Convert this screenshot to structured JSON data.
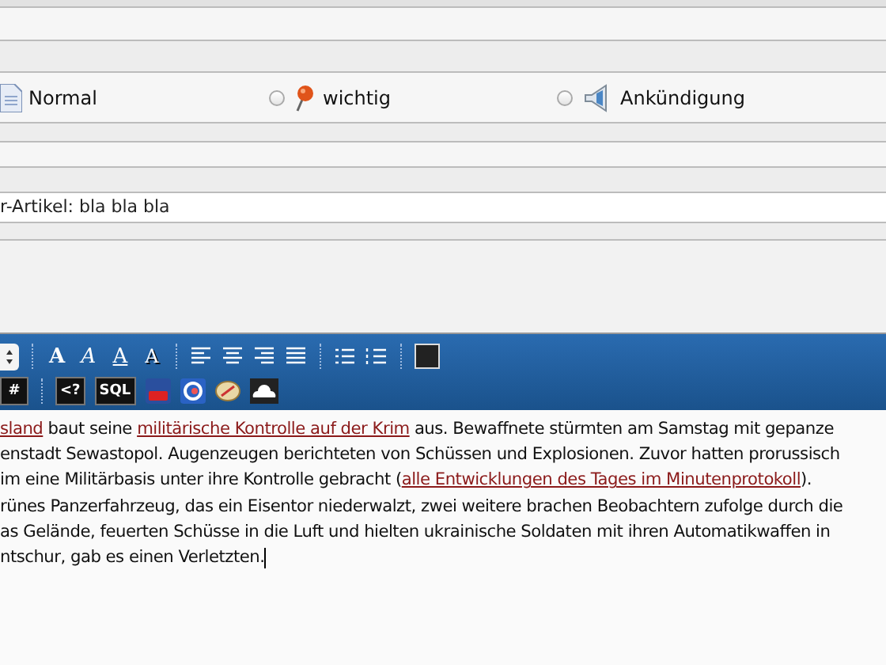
{
  "post_type": {
    "options": [
      {
        "label": "Normal",
        "kind": "page"
      },
      {
        "label": "wichtig",
        "kind": "pin",
        "selected": false
      },
      {
        "label": "Ankündigung",
        "kind": "speaker",
        "selected": false
      }
    ]
  },
  "title_field": {
    "value": "r-Artikel: bla bla bla"
  },
  "toolbar": {
    "format_buttons": [
      {
        "glyph": "A",
        "kind": "bold"
      },
      {
        "glyph": "A",
        "kind": "italic"
      },
      {
        "glyph": "A",
        "kind": "underline"
      },
      {
        "glyph": "A",
        "kind": "shadow"
      }
    ],
    "code_buttons": [
      {
        "glyph": "#"
      },
      {
        "glyph": "<?"
      },
      {
        "glyph": "SQL"
      }
    ]
  },
  "editor": {
    "lines": [
      [
        {
          "text": "sland",
          "link": true
        },
        {
          "text": " baut seine ",
          "link": false
        },
        {
          "text": "militärische Kontrolle auf der Krim",
          "link": true
        },
        {
          "text": " aus. Bewaffnete stürmten am Samstag mit gepanze",
          "link": false
        }
      ],
      [
        {
          "text": "enstadt Sewastopol. Augenzeugen berichteten von Schüssen und Explosionen. Zuvor hatten prorussisch",
          "link": false
        }
      ],
      [
        {
          "text": "im eine Militärbasis unter ihre Kontrolle gebracht (",
          "link": false
        },
        {
          "text": "alle Entwicklungen des Tages im Minutenprotokoll",
          "link": true
        },
        {
          "text": ").",
          "link": false
        }
      ],
      [
        {
          "text": "rünes Panzerfahrzeug, das ein Eisentor niederwalzt, zwei weitere brachen Beobachtern zufolge durch die",
          "link": false
        }
      ],
      [
        {
          "text": "as Gelände, feuerten Schüsse in die Luft und hielten ukrainische Soldaten mit ihren Automatikwaffen in",
          "link": false
        }
      ],
      [
        {
          "text": "ntschur, gab es einen Verletzten.",
          "link": false
        }
      ]
    ]
  }
}
